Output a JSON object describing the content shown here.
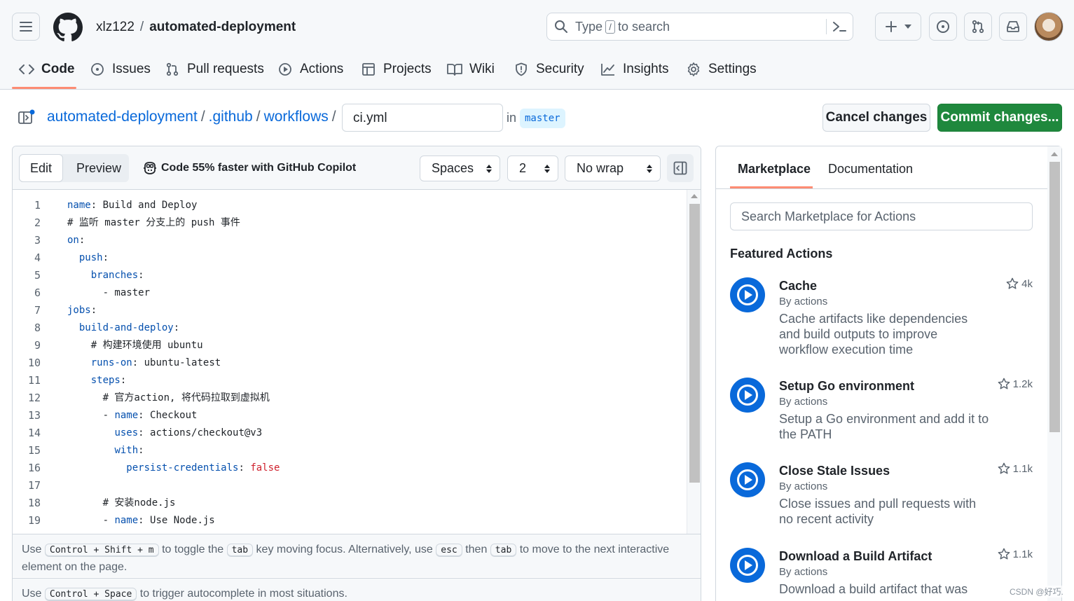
{
  "header": {
    "owner": "xlz122",
    "repo": "automated-deployment",
    "search_prefix": "Type",
    "search_key": "/",
    "search_suffix": "to search"
  },
  "tabs": [
    {
      "label": "Code",
      "icon": "code-icon"
    },
    {
      "label": "Issues",
      "icon": "issue-icon"
    },
    {
      "label": "Pull requests",
      "icon": "pull-request-icon"
    },
    {
      "label": "Actions",
      "icon": "play-icon"
    },
    {
      "label": "Projects",
      "icon": "table-icon"
    },
    {
      "label": "Wiki",
      "icon": "book-icon"
    },
    {
      "label": "Security",
      "icon": "shield-icon"
    },
    {
      "label": "Insights",
      "icon": "graph-icon"
    },
    {
      "label": "Settings",
      "icon": "gear-icon"
    }
  ],
  "path": {
    "repo": "automated-deployment",
    "dir1": ".github",
    "dir2": "workflows",
    "sep": "/",
    "filename": "ci.yml",
    "in_label": "in",
    "branch": "master"
  },
  "actions": {
    "cancel": "Cancel changes",
    "commit": "Commit changes..."
  },
  "editor": {
    "edit_tab": "Edit",
    "preview_tab": "Preview",
    "copilot": "Code 55% faster with GitHub Copilot",
    "indent_mode": "Spaces",
    "indent_size": "2",
    "wrap_mode": "No wrap",
    "lines": [
      {
        "n": "1",
        "indent": "",
        "key": "name",
        "colon": ":",
        "val": " Build and Deploy",
        "vclass": ""
      },
      {
        "n": "2",
        "indent": "",
        "key": "",
        "colon": "",
        "val": "# 监听 master 分支上的 push 事件",
        "vclass": ""
      },
      {
        "n": "3",
        "indent": "",
        "key": "on",
        "colon": ":",
        "val": "",
        "vclass": ""
      },
      {
        "n": "4",
        "indent": "  ",
        "key": "push",
        "colon": ":",
        "val": "",
        "vclass": ""
      },
      {
        "n": "5",
        "indent": "    ",
        "key": "branches",
        "colon": ":",
        "val": "",
        "vclass": ""
      },
      {
        "n": "6",
        "indent": "      ",
        "key": "",
        "colon": "",
        "val": "- master",
        "vclass": ""
      },
      {
        "n": "7",
        "indent": "",
        "key": "jobs",
        "colon": ":",
        "val": "",
        "vclass": ""
      },
      {
        "n": "8",
        "indent": "  ",
        "key": "build-and-deploy",
        "colon": ":",
        "val": "",
        "vclass": ""
      },
      {
        "n": "9",
        "indent": "    ",
        "key": "",
        "colon": "",
        "val": "# 构建环境使用 ubuntu",
        "vclass": ""
      },
      {
        "n": "10",
        "indent": "    ",
        "key": "runs-on",
        "colon": ":",
        "val": " ubuntu-latest",
        "vclass": ""
      },
      {
        "n": "11",
        "indent": "    ",
        "key": "steps",
        "colon": ":",
        "val": "",
        "vclass": ""
      },
      {
        "n": "12",
        "indent": "      ",
        "key": "",
        "colon": "",
        "val": "# 官方action, 将代码拉取到虚拟机",
        "vclass": ""
      },
      {
        "n": "13",
        "indent": "      - ",
        "key": "name",
        "colon": ":",
        "val": " Checkout",
        "vclass": ""
      },
      {
        "n": "14",
        "indent": "        ",
        "key": "uses",
        "colon": ":",
        "val": " actions/checkout@v3",
        "vclass": ""
      },
      {
        "n": "15",
        "indent": "        ",
        "key": "with",
        "colon": ":",
        "val": "",
        "vclass": ""
      },
      {
        "n": "16",
        "indent": "          ",
        "key": "persist-credentials",
        "colon": ":",
        "val": " false",
        "vclass": "r"
      },
      {
        "n": "17",
        "indent": "",
        "key": "",
        "colon": "",
        "val": "",
        "vclass": ""
      },
      {
        "n": "18",
        "indent": "      ",
        "key": "",
        "colon": "",
        "val": "# 安装node.js",
        "vclass": ""
      },
      {
        "n": "19",
        "indent": "      - ",
        "key": "name",
        "colon": ":",
        "val": " Use Node.js",
        "vclass": ""
      }
    ],
    "hint1": {
      "a": "Use",
      "k1": "Control + Shift + m",
      "b": "to toggle the",
      "k2": "tab",
      "c": "key moving focus. Alternatively, use",
      "k3": "esc",
      "d": "then",
      "k4": "tab",
      "e": "to move to the next interactive element on the page."
    },
    "hint2": {
      "a": "Use",
      "k1": "Control + Space",
      "b": "to trigger autocomplete in most situations."
    }
  },
  "marketplace": {
    "tab_marketplace": "Marketplace",
    "tab_docs": "Documentation",
    "search_placeholder": "Search Marketplace for Actions",
    "featured_title": "Featured Actions",
    "items": [
      {
        "name": "Cache",
        "by": "By actions",
        "desc": "Cache artifacts like dependencies and build outputs to improve workflow execution time",
        "stars": "4k"
      },
      {
        "name": "Setup Go environment",
        "by": "By actions",
        "desc": "Setup a Go environment and add it to the PATH",
        "stars": "1.2k"
      },
      {
        "name": "Close Stale Issues",
        "by": "By actions",
        "desc": "Close issues and pull requests with no recent activity",
        "stars": "1.1k"
      },
      {
        "name": "Download a Build Artifact",
        "by": "By actions",
        "desc": "Download a build artifact that was",
        "stars": "1.1k"
      }
    ]
  },
  "watermark": "CSDN @好巧.",
  "colors": {
    "accent": "#0969da",
    "commit_green": "#1f883d",
    "tab_underline": "#fd8c73"
  }
}
